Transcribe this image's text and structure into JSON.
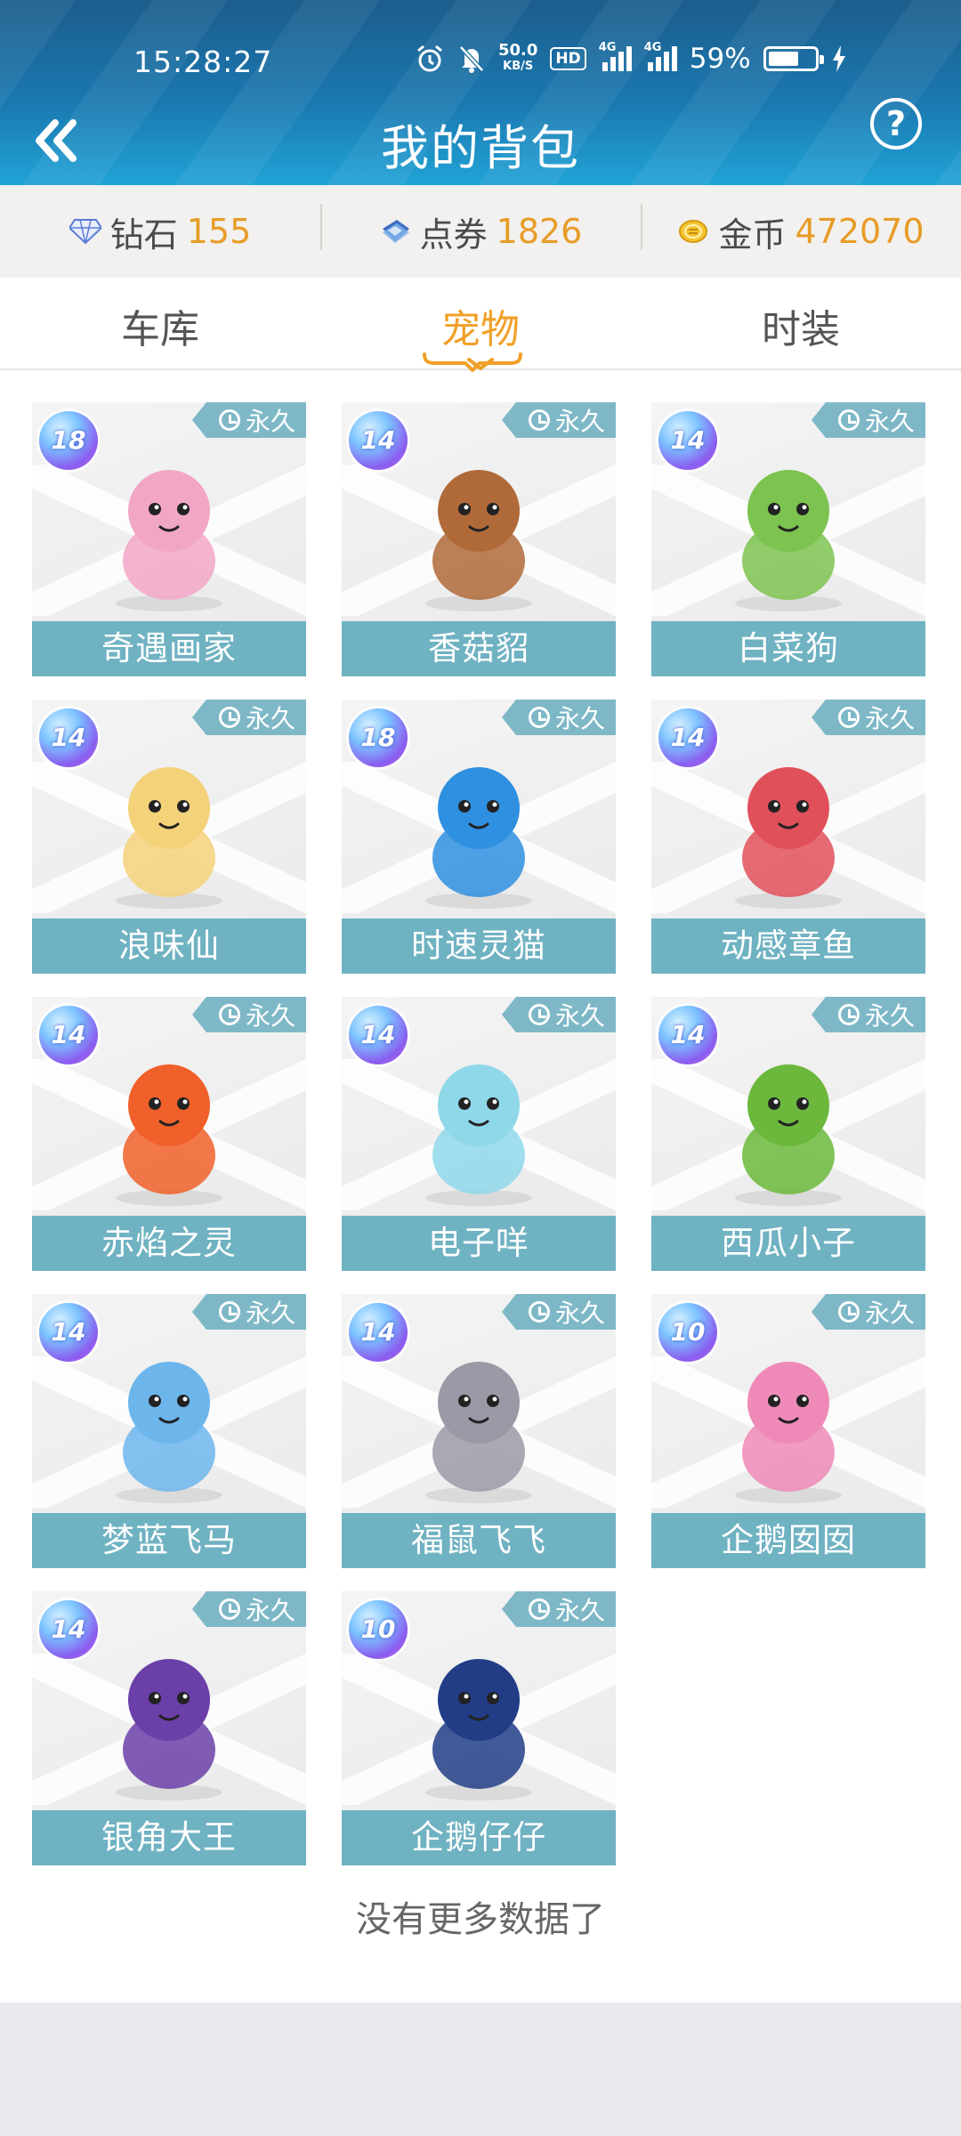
{
  "status_bar": {
    "time": "15:28:27",
    "net_speed": "50.0",
    "net_unit": "KB/S",
    "hd": "HD",
    "sig1": "4G",
    "sig2": "4G",
    "battery": "59%"
  },
  "header": {
    "title": "我的背包",
    "help": "?"
  },
  "currency": [
    {
      "label": "钻石",
      "value": "155",
      "icon": "diamond-icon"
    },
    {
      "label": "点券",
      "value": "1826",
      "icon": "coupon-icon"
    },
    {
      "label": "金币",
      "value": "472070",
      "icon": "gold-coin-icon"
    }
  ],
  "tabs": [
    {
      "label": "车库",
      "active": false
    },
    {
      "label": "宠物",
      "active": true
    },
    {
      "label": "时装",
      "active": false
    }
  ],
  "pets": [
    {
      "name": "奇遇画家",
      "level": "18",
      "duration": "永久",
      "color": "#f2a6c6"
    },
    {
      "name": "香菇貂",
      "level": "14",
      "duration": "永久",
      "color": "#b06a3a"
    },
    {
      "name": "白菜狗",
      "level": "14",
      "duration": "永久",
      "color": "#7cc34f"
    },
    {
      "name": "浪味仙",
      "level": "14",
      "duration": "永久",
      "color": "#f4d27a"
    },
    {
      "name": "时速灵猫",
      "level": "18",
      "duration": "永久",
      "color": "#2f8fe0"
    },
    {
      "name": "动感章鱼",
      "level": "14",
      "duration": "永久",
      "color": "#e0505a"
    },
    {
      "name": "赤焰之灵",
      "level": "14",
      "duration": "永久",
      "color": "#f0602a"
    },
    {
      "name": "电子咩",
      "level": "14",
      "duration": "永久",
      "color": "#8fd8ea"
    },
    {
      "name": "西瓜小子",
      "level": "14",
      "duration": "永久",
      "color": "#6bb83c"
    },
    {
      "name": "梦蓝飞马",
      "level": "14",
      "duration": "永久",
      "color": "#6cb6ec"
    },
    {
      "name": "福鼠飞飞",
      "level": "14",
      "duration": "永久",
      "color": "#9a9aa6"
    },
    {
      "name": "企鹅囡囡",
      "level": "10",
      "duration": "永久",
      "color": "#ef8ab8"
    },
    {
      "name": "银角大王",
      "level": "14",
      "duration": "永久",
      "color": "#6a3fa8"
    },
    {
      "name": "企鹅仔仔",
      "level": "10",
      "duration": "永久",
      "color": "#223d86"
    }
  ],
  "footer": "没有更多数据了"
}
